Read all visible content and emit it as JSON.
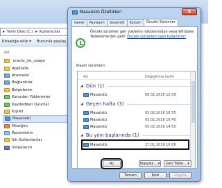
{
  "explorer": {
    "address_parts": [
      "Yerel Disk (C:)",
      "Kullanıcılar"
    ],
    "toolbar": {
      "include_library": "Kitaplığa ekle",
      "share": "Bununla paylaş"
    },
    "column_name": "Ad",
    "tree": [
      {
        "label": ".oracle_jre_usage",
        "icon": "folder-icon"
      },
      {
        "label": "AppData",
        "icon": "folder-icon"
      },
      {
        "label": "Aramalar",
        "icon": "search-folder-icon"
      },
      {
        "label": "Bağlantılar",
        "icon": "links-folder-icon"
      },
      {
        "label": "Belgelerim",
        "icon": "documents-folder-icon"
      },
      {
        "label": "Karşıdan Yüklemeler",
        "icon": "downloads-folder-icon"
      },
      {
        "label": "Kaydedilen Oyunlar",
        "icon": "games-folder-icon"
      },
      {
        "label": "Kişiler",
        "icon": "contacts-folder-icon"
      },
      {
        "label": "Masaüstü",
        "icon": "desktop-folder-icon",
        "selected": true
      },
      {
        "label": "Müziğim",
        "icon": "music-folder-icon"
      },
      {
        "label": "Resimlerim",
        "icon": "pictures-folder-icon"
      },
      {
        "label": "Sık Kullanılanlar",
        "icon": "favorites-folder-icon"
      },
      {
        "label": "Videolarım",
        "icon": "videos-folder-icon"
      }
    ]
  },
  "dialog": {
    "title": "Masaüstü Özellikleri",
    "tabs": [
      "Genel",
      "Paylaşım",
      "Güvenlik",
      "Konum",
      "Önceki Sürümler"
    ],
    "active_tab": "Önceki Sürümler",
    "info_text": "Önceki sürümler geri yükleme noktalarından veya Windows Yedekleme'den gelir.",
    "info_link": "Önceki sürümleri nasıl kullanırım?",
    "folder_versions_label": "Klasör sürümleri:",
    "columns": {
      "name": "Ad",
      "modified": "Değiştirme tarihi"
    },
    "groups": [
      {
        "title": "Dün (1)",
        "rows": [
          {
            "name": "Masaüstü",
            "date": "08.02.2016 15:09"
          }
        ]
      },
      {
        "title": "Geçen hafta (3)",
        "rows": [
          {
            "name": "Masaüstü",
            "date": "05.02.2016 18:55"
          },
          {
            "name": "Masaüstü",
            "date": "05.02.2016 16:45"
          },
          {
            "name": "Masaüstü",
            "date": "05.02.2016 14:55"
          }
        ]
      },
      {
        "title": "Bu yılın başlarında (1)",
        "rows": [
          {
            "name": "Masaüstü",
            "date": "27.01.2016 16:06"
          }
        ]
      }
    ],
    "buttons": {
      "open": "Aç",
      "copy": "Kopyala...",
      "restore": "Geri Yükle...",
      "ok": "Tamam",
      "cancel": "İptal",
      "apply": "Uygula"
    },
    "close_glyph": "X"
  }
}
